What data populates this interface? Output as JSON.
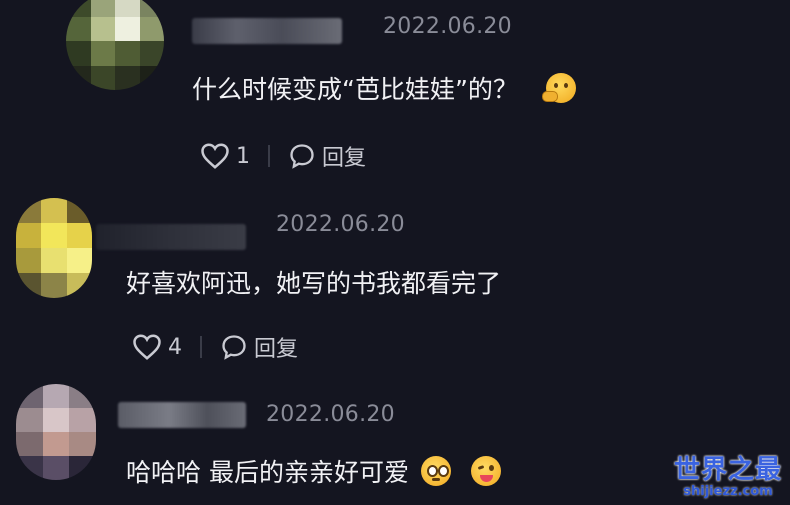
{
  "comments": [
    {
      "date": "2022.06.20",
      "text": "什么时候变成“芭比娃娃”的？",
      "emoji": "thinking-face",
      "likes": "1",
      "reply_label": "回复"
    },
    {
      "date": "2022.06.20",
      "text": "好喜欢阿迅，她写的书我都看完了",
      "likes": "4",
      "reply_label": "回复"
    },
    {
      "date": "2022.06.20",
      "text": "哈哈哈 最后的亲亲好可爱",
      "emojis": [
        "pleading-face",
        "winking-tongue-face"
      ]
    }
  ],
  "watermark": {
    "title": "世界之最",
    "url": "shijiezz.com"
  },
  "colors": {
    "background": "#141520",
    "date": "#8a8c98",
    "action": "#c9cad2",
    "watermark": "#3a63e0"
  }
}
